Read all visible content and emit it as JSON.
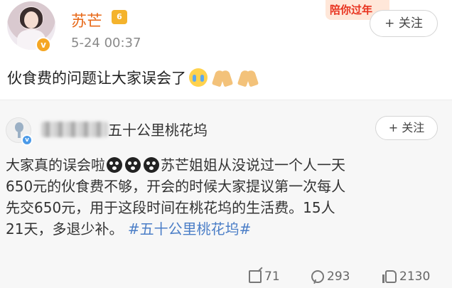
{
  "post": {
    "username": "苏芒",
    "level": "6",
    "verified_mark": "v",
    "timestamp": "5-24 00:37",
    "promo_badge": "陪你过年",
    "follow_label": "+ 关注",
    "text": "伙食费的问题让大家误会了",
    "emojis": [
      "crying-face-icon",
      "praying-hands-icon",
      "praying-hands-icon"
    ]
  },
  "retweet": {
    "author_name": "五十公里桃花坞",
    "verified_mark": "v",
    "follow_label": "+ 关注",
    "lines": [
      {
        "before": "大家真的误会啦",
        "after": "苏芒姐姐从没说过一个人一天"
      },
      {
        "text": "650元的伙食费不够，开会的时候大家提议第一次每人"
      },
      {
        "text": "先交650元，用于这段时间在桃花坞的生活费。15人"
      },
      {
        "text": "21天，多退少补。",
        "hashtag": "#五十公里桃花坞#"
      }
    ],
    "stats": {
      "shares": "71",
      "comments": "293",
      "likes": "2130"
    }
  },
  "colors": {
    "username": "#e86a1a",
    "hashtag": "#4b7ec7",
    "promo": "#e8321e"
  }
}
